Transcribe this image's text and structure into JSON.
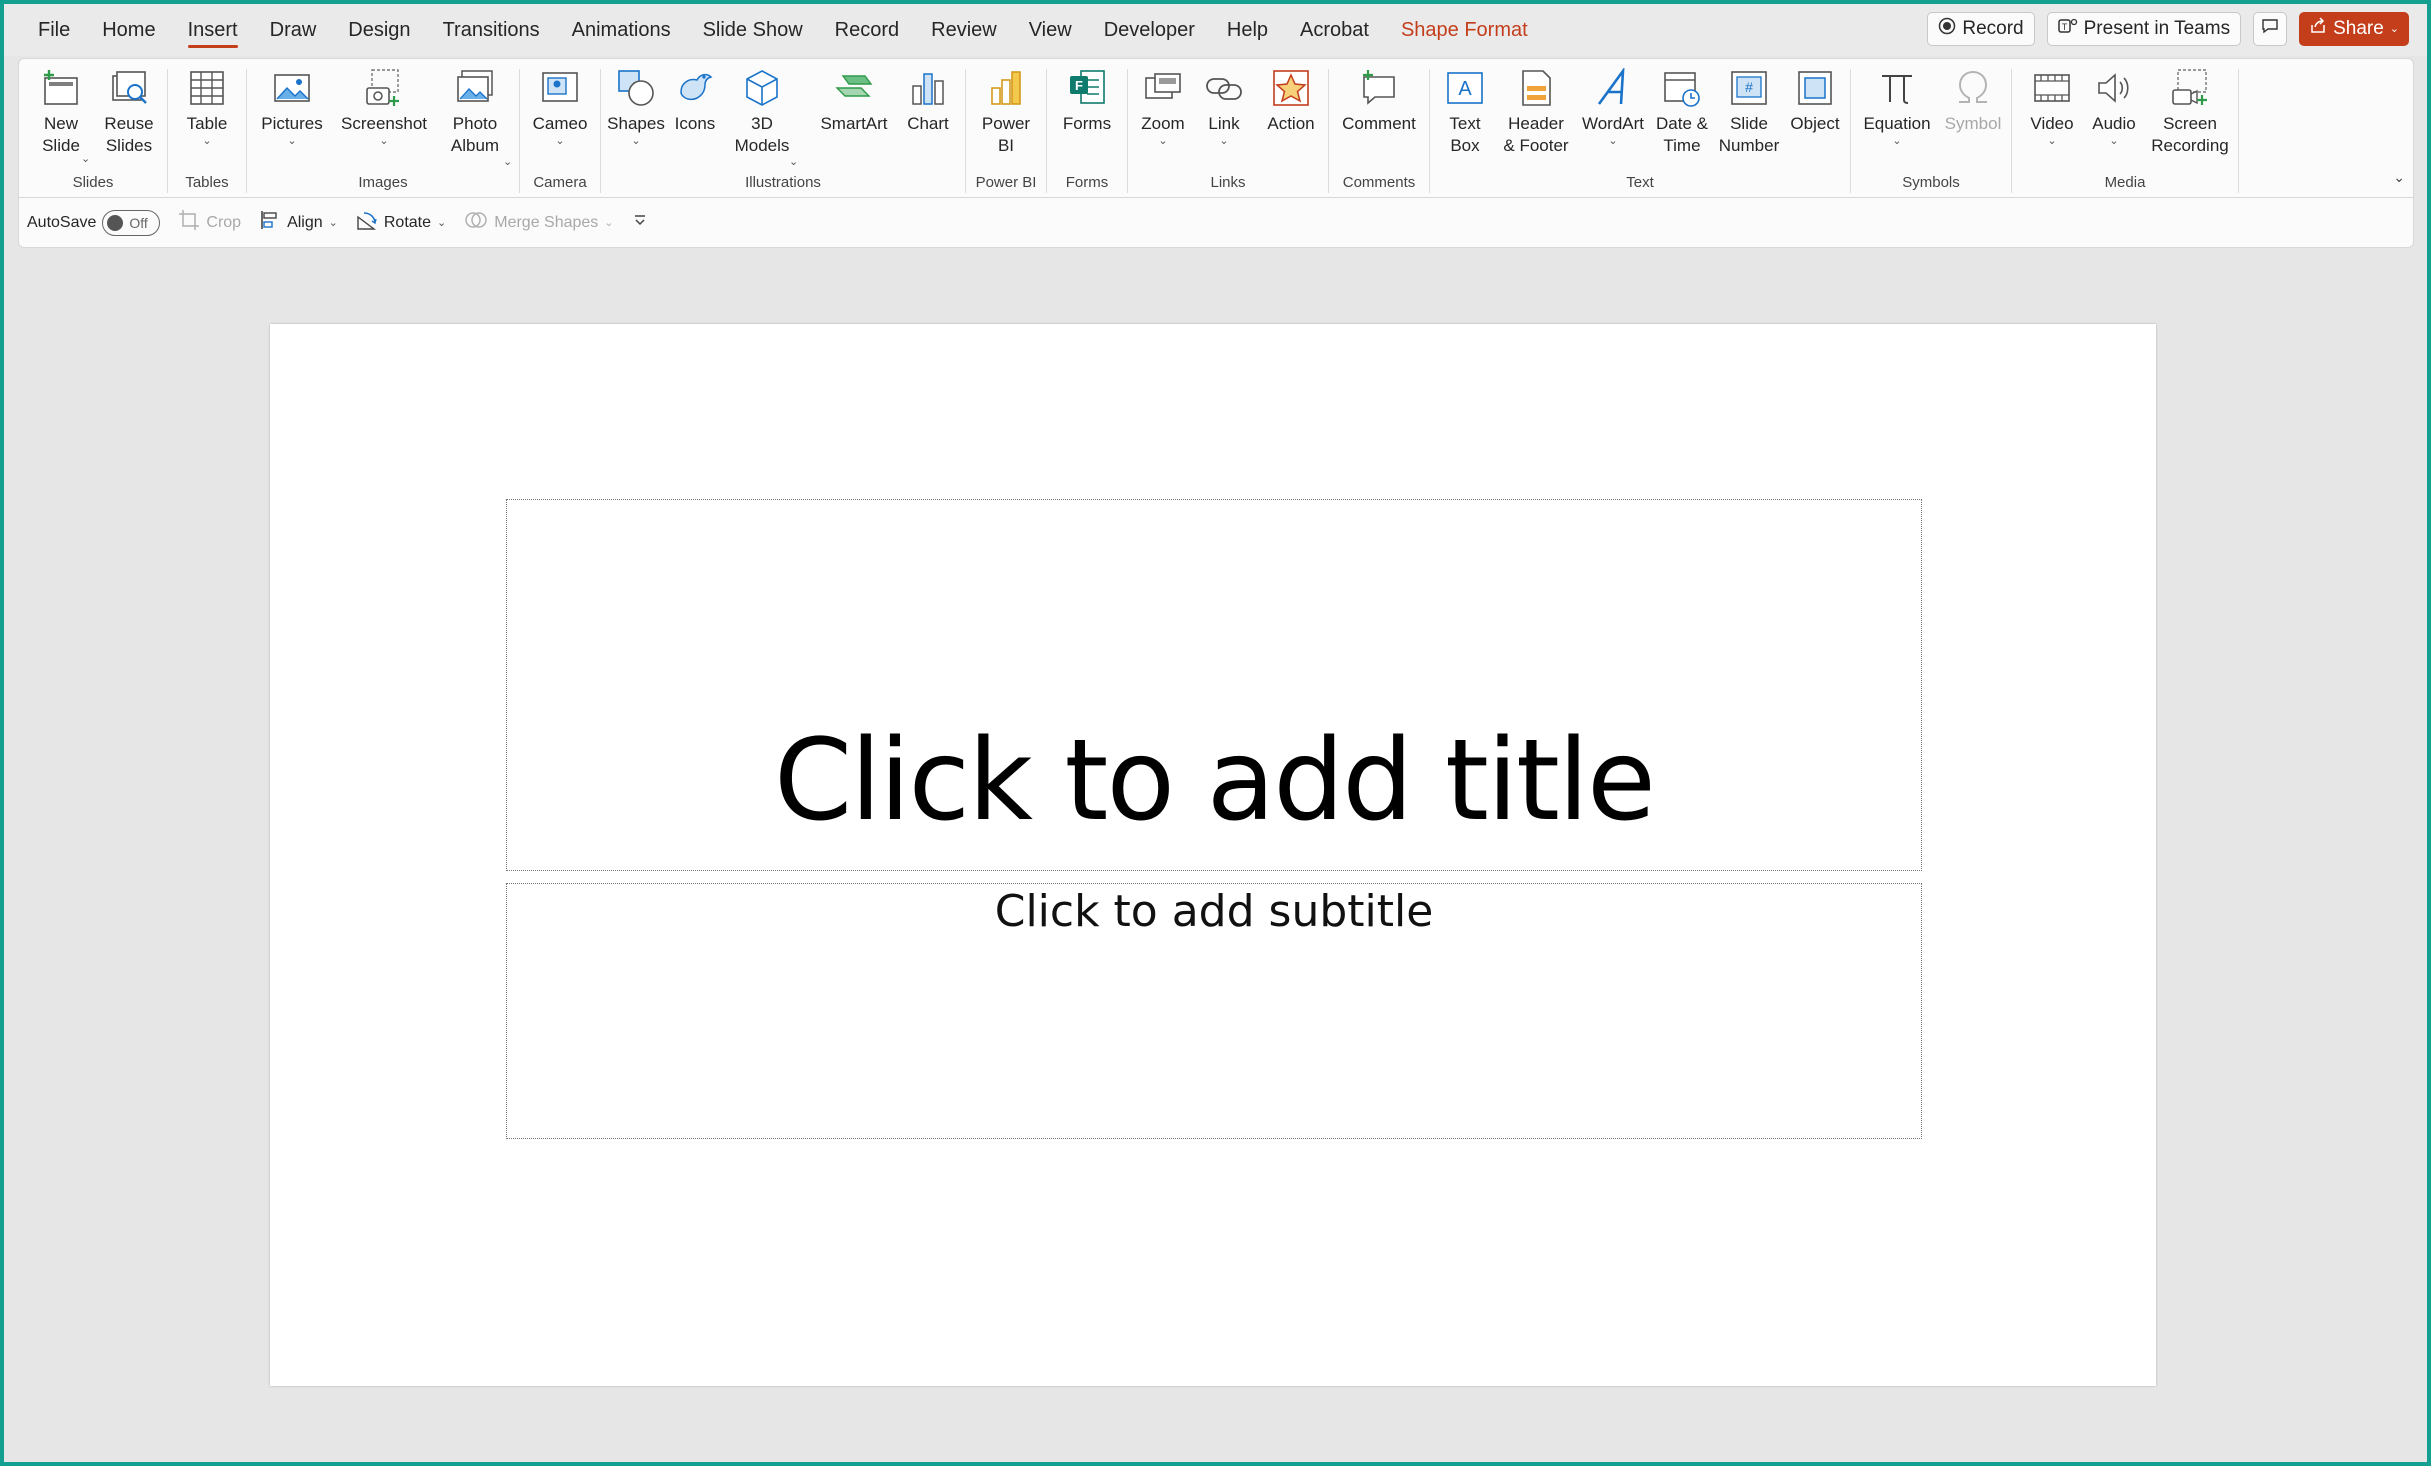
{
  "menu": {
    "tabs": [
      "File",
      "Home",
      "Insert",
      "Draw",
      "Design",
      "Transitions",
      "Animations",
      "Slide Show",
      "Record",
      "Review",
      "View",
      "Developer",
      "Help",
      "Acrobat",
      "Shape Format"
    ],
    "active_tab": "Insert",
    "contextual_tab": "Shape Format"
  },
  "top_right": {
    "record_label": "Record",
    "present_label": "Present in Teams",
    "share_label": "Share"
  },
  "ribbon": {
    "groups": {
      "slides": "Slides",
      "tables": "Tables",
      "images": "Images",
      "camera": "Camera",
      "illustrations": "Illustrations",
      "powerbi": "Power BI",
      "forms": "Forms",
      "links": "Links",
      "comments": "Comments",
      "text": "Text",
      "symbols": "Symbols",
      "media": "Media"
    },
    "buttons": {
      "new_slide": "New\nSlide",
      "reuse_slides": "Reuse\nSlides",
      "table": "Table",
      "pictures": "Pictures",
      "screenshot": "Screenshot",
      "photo_album": "Photo\nAlbum",
      "cameo": "Cameo",
      "shapes": "Shapes",
      "icons": "Icons",
      "models_3d": "3D\nModels",
      "smartart": "SmartArt",
      "chart": "Chart",
      "power_bi": "Power\nBI",
      "forms": "Forms",
      "zoom": "Zoom",
      "link": "Link",
      "action": "Action",
      "comment": "Comment",
      "text_box": "Text\nBox",
      "header_footer": "Header\n& Footer",
      "wordart": "WordArt",
      "date_time": "Date &\nTime",
      "slide_number": "Slide\nNumber",
      "object": "Object",
      "equation": "Equation",
      "symbol": "Symbol",
      "video": "Video",
      "audio": "Audio",
      "screen_recording": "Screen\nRecording"
    }
  },
  "qat": {
    "autosave_label": "AutoSave",
    "autosave_state": "Off",
    "crop": "Crop",
    "align": "Align",
    "rotate": "Rotate",
    "merge_shapes": "Merge Shapes"
  },
  "slide": {
    "title_placeholder": "Click to add title",
    "subtitle_placeholder": "Click to add subtitle"
  },
  "colors": {
    "accent": "#c43e1c",
    "frame": "#13a090"
  }
}
